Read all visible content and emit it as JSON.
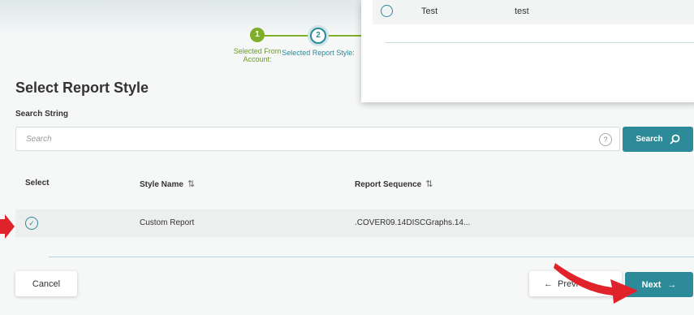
{
  "stepper": {
    "steps": [
      {
        "number": "1",
        "label": "Selected From Account:"
      },
      {
        "number": "2",
        "label": "Selected Report Style:"
      }
    ]
  },
  "overlay": {
    "row": {
      "name": "Test",
      "value": "test"
    }
  },
  "page": {
    "title": "Select Report Style"
  },
  "search": {
    "label": "Search String",
    "placeholder": "Search",
    "help": "?",
    "button_label": "Search"
  },
  "table": {
    "headers": {
      "select": "Select",
      "style_name": "Style Name",
      "report_sequence": "Report Sequence"
    },
    "rows": [
      {
        "style_name": "Custom Report",
        "report_sequence": ".COVER09.14DISCGraphs.14..."
      }
    ]
  },
  "footer": {
    "cancel_label": "Cancel",
    "previous_label": "Previ",
    "next_label": "Next"
  },
  "colors": {
    "accent": "#2d8a99",
    "step_done": "#7fae2a",
    "annotation_arrow": "#e0232b"
  }
}
